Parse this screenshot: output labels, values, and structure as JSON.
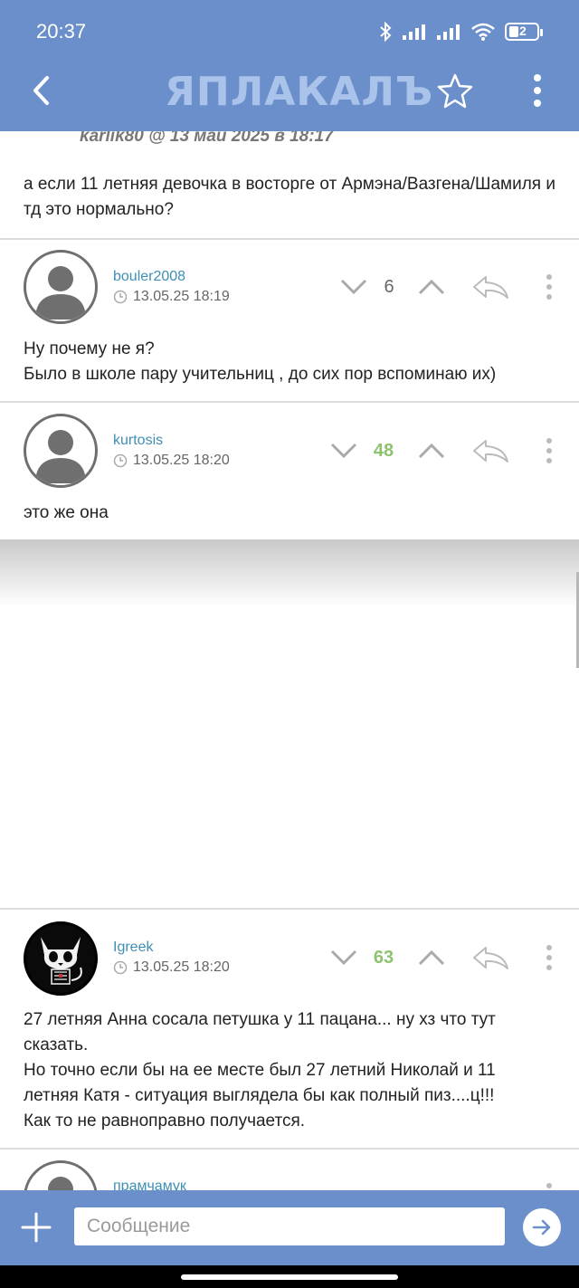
{
  "status_bar": {
    "time": "20:37",
    "battery": "2"
  },
  "app_bar": {
    "logo": "ЯПЛАКАЛЪ"
  },
  "partial_post": {
    "author_line": "karlik80 @ 13 май 2025 в 18:17",
    "text": "а если 11 летняя девочка в восторге от Армэна/Вазгена/Шамиля и тд это нормально?"
  },
  "comments": [
    {
      "author": "bouler2008",
      "date": "13.05.25 18:19",
      "votes": "6",
      "lines": [
        "Ну почему не я?",
        "Было в школе пару учительниц , до сих пор вспоминаю их)"
      ]
    },
    {
      "author": "kurtosis",
      "date": "13.05.25 18:20",
      "votes": "48",
      "lines": [
        "это же она"
      ]
    },
    {
      "author": "Igreek",
      "date": "13.05.25 18:20",
      "votes": "63",
      "lines": [
        "27 летняя Анна сосала петушка у 11 пацана... ну хз что тут",
        "сказать.",
        "Но точно если бы на ее месте был 27 летний Николай и 11",
        "летняя Катя - ситуация выглядела бы как полный пиз....ц!!!",
        "Как то не равноправно получается."
      ]
    },
    {
      "author": "прамчамук"
    }
  ],
  "composer": {
    "placeholder": "Сообщение"
  }
}
